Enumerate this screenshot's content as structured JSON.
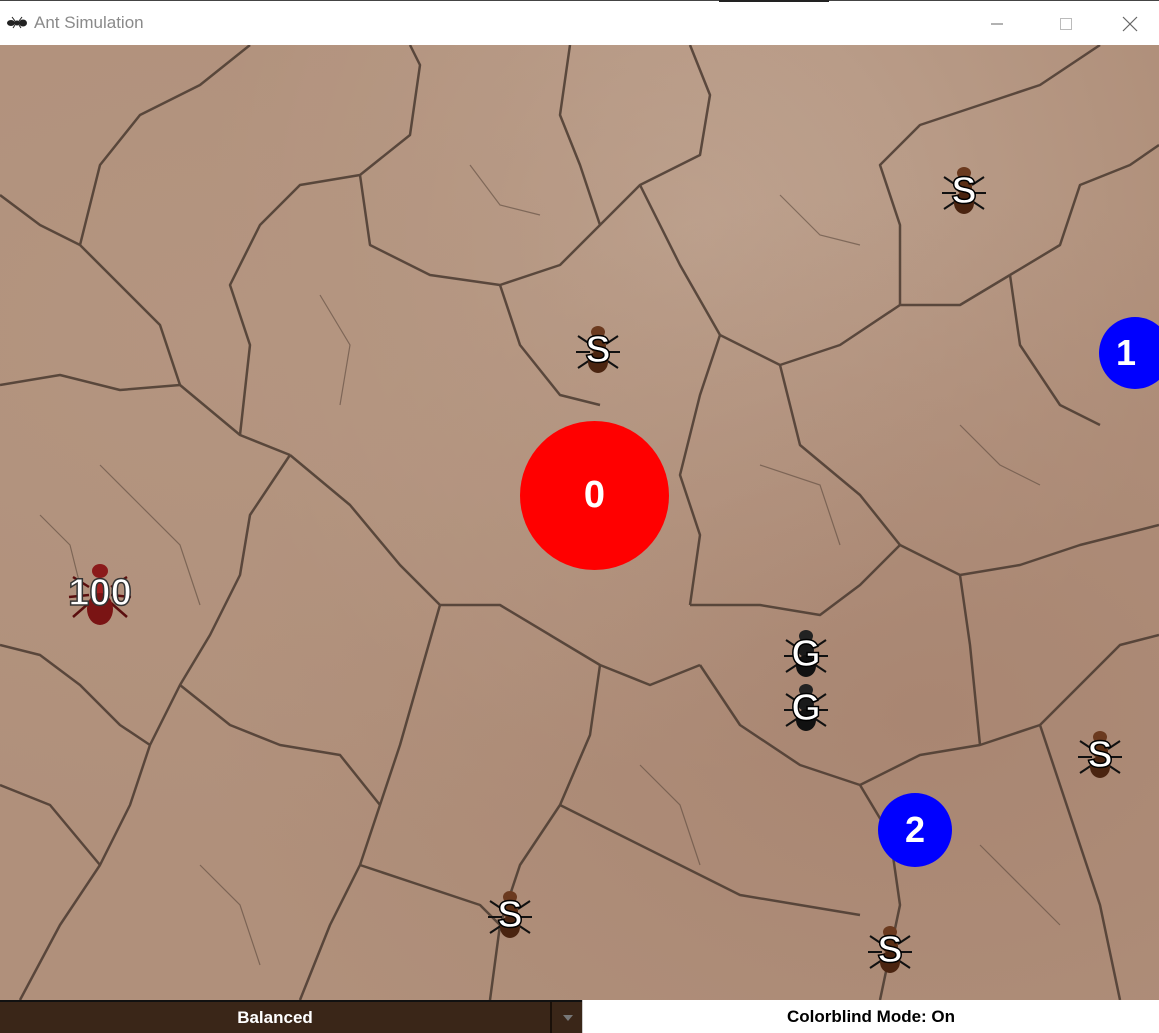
{
  "window": {
    "title": "Ant Simulation",
    "controls": [
      "minimize",
      "maximize",
      "close"
    ]
  },
  "field": {
    "nodes": [
      {
        "id": "node-0",
        "label": "0",
        "color": "#ff0000"
      },
      {
        "id": "node-1",
        "label": "1",
        "color": "#0000ff"
      },
      {
        "id": "node-2",
        "label": "2",
        "color": "#0000ff"
      }
    ],
    "queen": {
      "label": "100"
    },
    "ants": [
      {
        "label": "S"
      },
      {
        "label": "S"
      },
      {
        "label": "G"
      },
      {
        "label": "G"
      },
      {
        "label": "S"
      },
      {
        "label": "S"
      },
      {
        "label": "S"
      }
    ]
  },
  "bottom": {
    "mode_value": "Balanced",
    "colorblind_text": "Colorblind Mode: On"
  }
}
